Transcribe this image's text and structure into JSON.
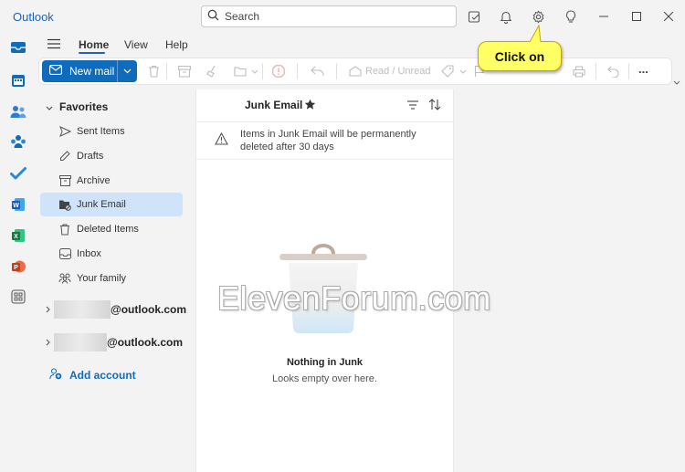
{
  "app": {
    "title": "Outlook"
  },
  "search": {
    "placeholder": "Search"
  },
  "menu": {
    "tabs": [
      "Home",
      "View",
      "Help"
    ],
    "active": "Home"
  },
  "ribbon": {
    "new_mail_label": "New mail",
    "read_unread_label": "Read / Unread",
    "more_label": "..."
  },
  "folders": {
    "favorites_label": "Favorites",
    "items": [
      {
        "label": "Sent Items",
        "icon": "send-icon"
      },
      {
        "label": "Drafts",
        "icon": "pencil-icon"
      },
      {
        "label": "Archive",
        "icon": "archive-icon"
      },
      {
        "label": "Junk Email",
        "icon": "junk-icon",
        "selected": true
      },
      {
        "label": "Deleted Items",
        "icon": "trash-icon"
      },
      {
        "label": "Inbox",
        "icon": "inbox-icon"
      },
      {
        "label": "Your family",
        "icon": "people-icon"
      }
    ],
    "accounts": [
      "@outlook.com",
      "@outlook.com"
    ],
    "add_account_label": "Add account"
  },
  "message_list": {
    "title": "Junk Email",
    "notice": "Items in Junk Email will be permanently deleted after 30 days",
    "empty_title": "Nothing in Junk",
    "empty_subtitle": "Looks empty over here."
  },
  "callout": {
    "text": "Click on"
  },
  "watermark": {
    "text": "ElevenForum.com"
  },
  "colors": {
    "accent": "#0f6cbd",
    "selected_bg": "#cfe4fa",
    "callout_bg": "#ffff66"
  }
}
